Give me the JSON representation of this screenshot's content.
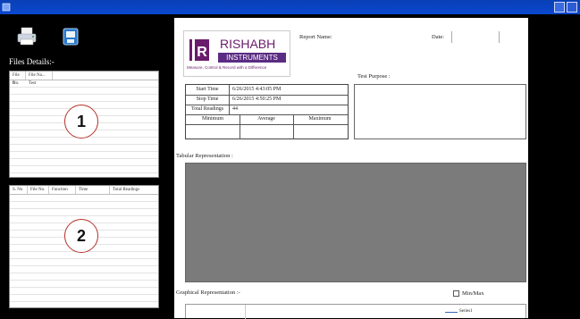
{
  "left": {
    "files_label": "Files Details:-",
    "list1": {
      "headers": [
        "File No.",
        "File Na..."
      ],
      "rows": [
        [
          "0",
          "Test"
        ]
      ],
      "badge": "1"
    },
    "list2": {
      "headers": [
        "S. No",
        "File No.",
        "Function",
        "Time",
        "Total Readings"
      ],
      "badge": "2"
    }
  },
  "report": {
    "logo": {
      "brand": "RISHABH",
      "sub": "INSTRUMENTS",
      "tagline": "Measure, Control & Record with a Difference"
    },
    "report_name_label": "Report Name:",
    "date_label": "Date:",
    "test_purpose_label": "Test Purpose :",
    "info": {
      "start_label": "Start Time",
      "start_value": "6/26/2015 4:43:05 PM",
      "stop_label": "Stop Time",
      "stop_value": "6/26/2015 4:50:25 PM",
      "readings_label": "Total Readings",
      "readings_value": "44",
      "minimum": "Minimum",
      "average": "Average",
      "maximum": "Maximum"
    },
    "tabular_label": "Tabular Representation :",
    "graphical_label": "Graphical Representation :-",
    "minmax_label": "Min/Max",
    "legend_label": "Series1"
  }
}
